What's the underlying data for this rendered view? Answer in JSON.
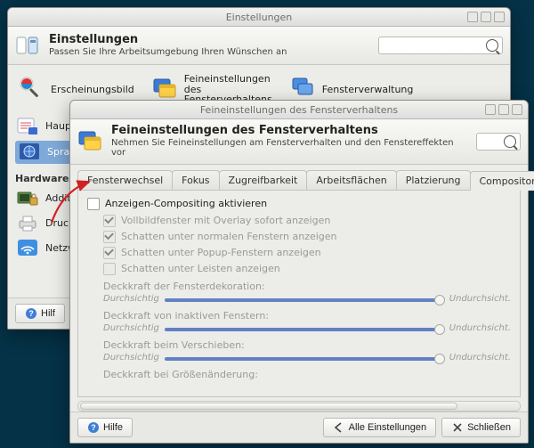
{
  "parent": {
    "window_title": "Einstellungen",
    "header_title": "Einstellungen",
    "header_sub": "Passen Sie Ihre Arbeitsumgebung Ihren Wünschen an",
    "launchers": [
      {
        "label": "Erscheinungsbild"
      },
      {
        "label_line1": "Feineinstellungen",
        "label_line2": "des",
        "label_line3": "Fensterverhaltens"
      },
      {
        "label": "Fensterverwaltung"
      }
    ],
    "side": [
      {
        "label": "Haupt"
      },
      {
        "label": "Sprac",
        "selected": true
      }
    ],
    "hardware_label": "Hardware",
    "hw_items": [
      {
        "label": "Additi"
      },
      {
        "label": "Druck"
      },
      {
        "label": "Netzw"
      }
    ],
    "help_label": "Hilf"
  },
  "child": {
    "window_title": "Feineinstellungen des Fensterverhaltens",
    "header_title": "Feineinstellungen des Fensterverhaltens",
    "header_sub": "Nehmen Sie Feineinstellungen am Fensterverhalten und den Fenstereffekten vor",
    "tabs": [
      "Fensterwechsel",
      "Fokus",
      "Zugreifbarkeit",
      "Arbeitsflächen",
      "Platzierung",
      "Compositor"
    ],
    "active_tab": 5,
    "top_check": "Anzeigen-Compositing aktivieren",
    "sub_checks": [
      {
        "label": "Vollbildfenster mit Overlay sofort anzeigen",
        "checked": true
      },
      {
        "label": "Schatten unter normalen Fenstern anzeigen",
        "checked": true
      },
      {
        "label": "Schatten unter Popup-Fenstern anzeigen",
        "checked": true
      },
      {
        "label": "Schatten unter Leisten anzeigen",
        "checked": false
      }
    ],
    "sliders": [
      {
        "label": "Deckkraft der Fensterdekoration:",
        "left": "Durchsichtig",
        "right": "Undurchsicht.",
        "pos": "right"
      },
      {
        "label": "Deckkraft von inaktiven Fenstern:",
        "left": "Durchsichtig",
        "right": "Undurchsicht.",
        "pos": "right"
      },
      {
        "label": "Deckkraft beim Verschieben:",
        "left": "Durchsichtig",
        "right": "Undurchsicht.",
        "pos": "right"
      },
      {
        "label": "Deckkraft bei Größenänderung:",
        "left": "",
        "right": "",
        "pos": "left"
      }
    ],
    "footer": {
      "help": "Hilfe",
      "all_settings": "Alle Einstellungen",
      "close": "Schließen"
    }
  }
}
